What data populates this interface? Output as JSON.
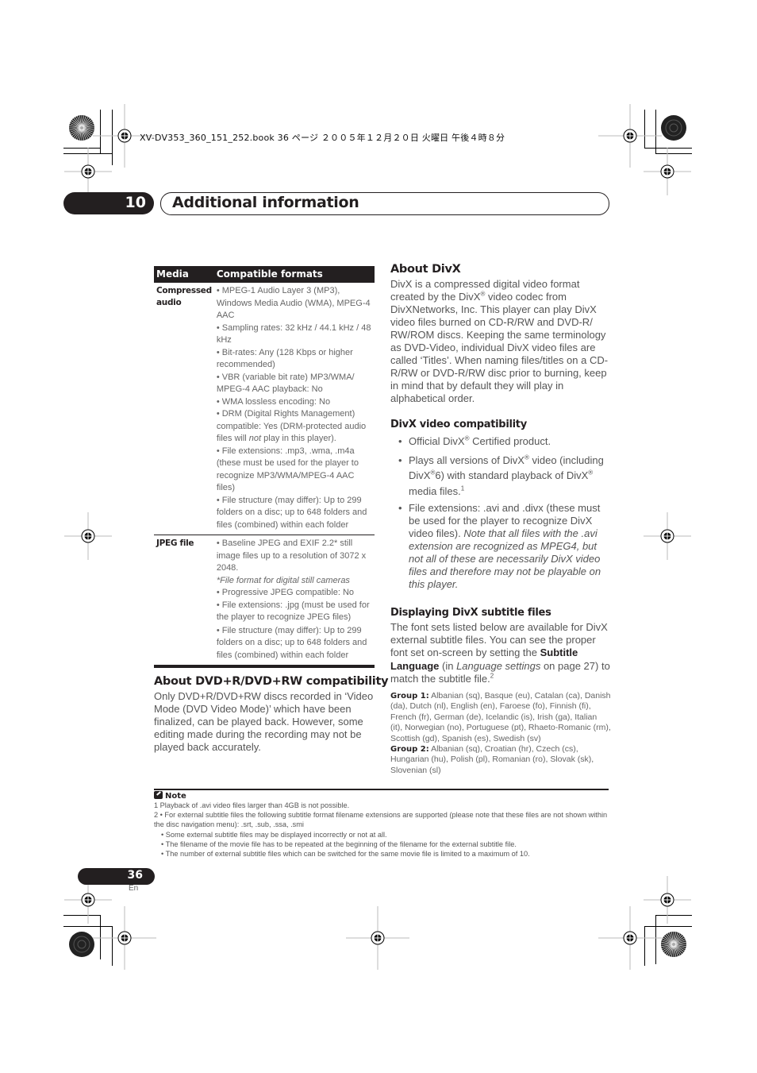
{
  "print_header": {
    "file_info": "XV-DV353_360_151_252.book  36 ページ  ２００５年１２月２０日  火曜日  午後４時８分"
  },
  "chapter": {
    "number": "10",
    "title": "Additional information"
  },
  "formats_table": {
    "headers": [
      "Media",
      "Compatible formats"
    ],
    "rows": [
      {
        "media": "Compressed audio",
        "items": [
          "• MPEG-1 Audio Layer 3 (MP3), Windows Media Audio (WMA), MPEG-4 AAC",
          "• Sampling rates: 32 kHz / 44.1 kHz  / 48 kHz",
          "• Bit-rates: Any (128 Kbps or higher recommended)",
          "• VBR (variable bit rate) MP3/WMA/ MPEG-4 AAC playback: No",
          "• WMA lossless encoding: No",
          {
            "before": "• DRM (Digital Rights Management) compatible: Yes (DRM-protected audio files will ",
            "italic": "not",
            "after": " play in this player)."
          },
          "• File extensions: .mp3, .wma, .m4a (these must be used for the player to recognize MP3/WMA/MPEG-4 AAC files)",
          "• File structure (may differ): Up to 299 folders on a disc; up to 648 folders and files (combined) within each folder"
        ]
      },
      {
        "media": "JPEG file",
        "items": [
          "• Baseline JPEG and EXIF 2.2* still image files up to a resolution of 3072 x 2048.",
          {
            "italic_line": "*File format for digital still cameras"
          },
          "• Progressive JPEG compatible: No",
          "• File extensions: .jpg (must be used for the player to recognize JPEG files)",
          "• File structure (may differ): Up to 299 folders on a disc; up to 648 folders and files (combined) within each folder"
        ]
      }
    ]
  },
  "dvd_plus_r": {
    "heading": "About DVD+R/DVD+RW compatibility",
    "body": "Only DVD+R/DVD+RW discs recorded in ‘Video Mode (DVD Video Mode)’ which have been finalized, can be played back. However, some editing made during the recording may not be played back accurately."
  },
  "about_divx": {
    "heading": "About DivX",
    "body_before_reg": "DivX is a compressed digital video format created by the DivX",
    "reg_mark": "®",
    "body_after_reg": " video codec from DivXNetworks, Inc. This player can play DivX video files burned on CD-R/RW and DVD-R/ RW/ROM discs. Keeping the same terminology as DVD-Video, individual DivX video files are called ‘Titles’. When naming files/titles on a CD-R/RW or DVD-R/RW disc prior to burning, keep in mind that by default they will play in alphabetical order."
  },
  "divx_compat": {
    "heading": "DivX video compatibility",
    "bullet1": {
      "a": "Official DivX",
      "reg": "®",
      "b": " Certified product."
    },
    "bullet2": {
      "a": "Plays all versions of DivX",
      "reg1": "®",
      "b": " video (including DivX",
      "reg2": "®",
      "c": "6) with standard playback of DivX",
      "reg3": "®",
      "d": " media files.",
      "footnote": "1"
    },
    "bullet3": {
      "plain": "File extensions: .avi and .divx (these must be used for the player to recognize DivX video files). ",
      "italic": "Note that all files with the .avi extension are recognized as MPEG4, but not all of these are necessarily DivX video files and therefore may not be playable on this player."
    }
  },
  "subtitles": {
    "heading": "Displaying DivX subtitle files",
    "text1": "The font sets listed below are available for DivX external subtitle files. You can see the proper font set on-screen by setting the ",
    "bold": "Subtitle Language",
    "text2": " (in ",
    "italic": "Language settings",
    "text3": " on page 27) to match the subtitle file.",
    "footnote": "2",
    "group1_label": "Group 1:",
    "group1": " Albanian (sq), Basque (eu), Catalan (ca), Danish (da), Dutch (nl), English (en), Faroese (fo), Finnish (fi), French (fr), German (de), Icelandic (is), Irish (ga), Italian (it), Norwegian (no), Portuguese (pt), Rhaeto-Romanic (rm), Scottish (gd), Spanish (es), Swedish (sv)",
    "group2_label": "Group 2:",
    "group2": " Albanian (sq), Croatian (hr), Czech (cs), Hungarian (hu), Polish (pl), Romanian (ro), Slovak (sk), Slovenian (sl)"
  },
  "notes": {
    "heading": "Note",
    "icon": "pencil-note-icon",
    "lines": [
      "1 Playback of .avi video files larger than 4GB is not possible.",
      "2  • For external subtitle files the following subtitle format filename extensions are supported (please note that these files are not shown within the disc navigation menu): .srt, .sub, .ssa, .smi",
      "• Some external subtitle files may be displayed incorrectly or not at all.",
      "• The filename of the movie file has to be repeated at the beginning of the filename for the external subtitle file.",
      "• The number of external subtitle files which can be switched for the same movie file is limited to a maximum of 10."
    ]
  },
  "footer": {
    "page_number": "36",
    "language": "En"
  }
}
